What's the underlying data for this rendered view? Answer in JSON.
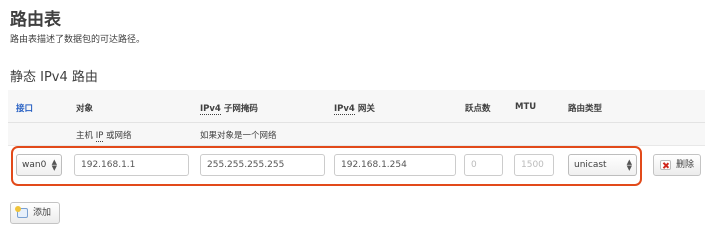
{
  "page": {
    "title": "路由表",
    "description": "路由表描述了数据包的可达路径。",
    "section_title": "静态 IPv4 路由"
  },
  "table": {
    "headers": {
      "interface": "接口",
      "target": "对象",
      "netmask_prefix": "IPv4",
      "netmask_rest": " 子网掩码",
      "gateway_prefix": "IPv4",
      "gateway_rest": " 网关",
      "metric": "跃点数",
      "mtu": "MTU",
      "route_type": "路由类型"
    },
    "subheaders": {
      "target_pre": "主机 ",
      "target_ip": "IP",
      "target_post": " 或网络",
      "netmask_hint": "如果对象是一个网络"
    },
    "row": {
      "interface": "wan0",
      "target": "192.168.1.1",
      "netmask": "255.255.255.255",
      "gateway": "192.168.1.254",
      "metric": "0",
      "mtu": "1500",
      "route_type": "unicast",
      "delete_label": "删除"
    }
  },
  "actions": {
    "add_label": "添加"
  },
  "colors": {
    "highlight": "#e24a1a",
    "link": "#2a62c4"
  }
}
